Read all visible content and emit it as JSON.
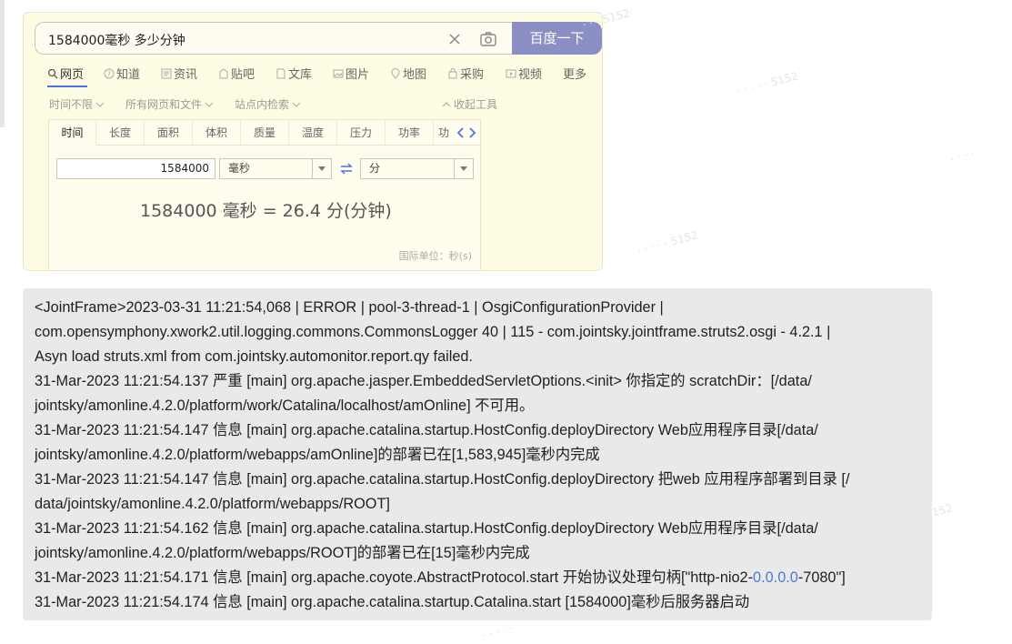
{
  "search": {
    "query": "1584000毫秒 多少分钟",
    "button_label": "百度一下"
  },
  "nav_tabs": [
    {
      "label": "网页",
      "icon": "search-icon"
    },
    {
      "label": "知道",
      "icon": "question-icon"
    },
    {
      "label": "资讯",
      "icon": "news-icon"
    },
    {
      "label": "贴吧",
      "icon": "tieba-icon"
    },
    {
      "label": "文库",
      "icon": "doc-icon"
    },
    {
      "label": "图片",
      "icon": "image-icon"
    },
    {
      "label": "地图",
      "icon": "map-pin-icon"
    },
    {
      "label": "采购",
      "icon": "shop-icon"
    },
    {
      "label": "视频",
      "icon": "video-icon"
    },
    {
      "label": "更多",
      "icon": ""
    }
  ],
  "tools": {
    "time_filter": "时间不限",
    "scope_filter": "所有网页和文件",
    "site_search": "站点内检索",
    "collapse": "收起工具"
  },
  "converter": {
    "unit_tabs": [
      "时间",
      "长度",
      "面积",
      "体积",
      "质量",
      "温度",
      "压力",
      "功率",
      "功"
    ],
    "input_value": "1584000",
    "from_unit": "毫秒",
    "to_unit": "分",
    "result": "1584000 毫秒 = 26.4 分(分钟)",
    "si_note": "国际单位：秒(s)"
  },
  "log": {
    "lines": [
      "<JointFrame>2023-03-31 11:21:54,068 | ERROR | pool-3-thread-1  | OsgiConfigurationProvider        |",
      "com.opensymphony.xwork2.util.logging.commons.CommonsLogger   40 | 115 - com.jointsky.jointframe.struts2.osgi - 4.2.1 |",
      "Asyn load struts.xml from com.jointsky.automonitor.report.qy failed.",
      "31-Mar-2023 11:21:54.137 严重 [main] org.apache.jasper.EmbeddedServletOptions.<init> 你指定的 scratchDir：[/data/",
      "jointsky/amonline.4.2.0/platform/work/Catalina/localhost/amOnline] 不可用。",
      "31-Mar-2023 11:21:54.147 信息 [main] org.apache.catalina.startup.HostConfig.deployDirectory Web应用程序目录[/data/",
      "jointsky/amonline.4.2.0/platform/webapps/amOnline]的部署已在[1,583,945]毫秒内完成",
      "31-Mar-2023 11:21:54.147 信息 [main] org.apache.catalina.startup.HostConfig.deployDirectory 把web 应用程序部署到目录 [/",
      "data/jointsky/amonline.4.2.0/platform/webapps/ROOT]",
      "31-Mar-2023 11:21:54.162 信息 [main] org.apache.catalina.startup.HostConfig.deployDirectory Web应用程序目录[/data/",
      "jointsky/amonline.4.2.0/platform/webapps/ROOT]的部署已在[15]毫秒内完成"
    ],
    "line_protocol": {
      "before": "31-Mar-2023 11:21:54.171 信息 [main] org.apache.coyote.AbstractProtocol.start 开始协议处理句柄[\"http-nio2-",
      "ip": "0.0.0.0",
      "after": "-7080\"]"
    },
    "last_line": "31-Mar-2023 11:21:54.174 信息 [main] org.apache.catalina.startup.Catalina.start [1584000]毫秒后服务器启动"
  },
  "colors": {
    "search_button": "#8b8fc4",
    "card_background": "#fefce2",
    "log_background": "#e9e9e9",
    "ip_link": "#4a7bd3"
  }
}
